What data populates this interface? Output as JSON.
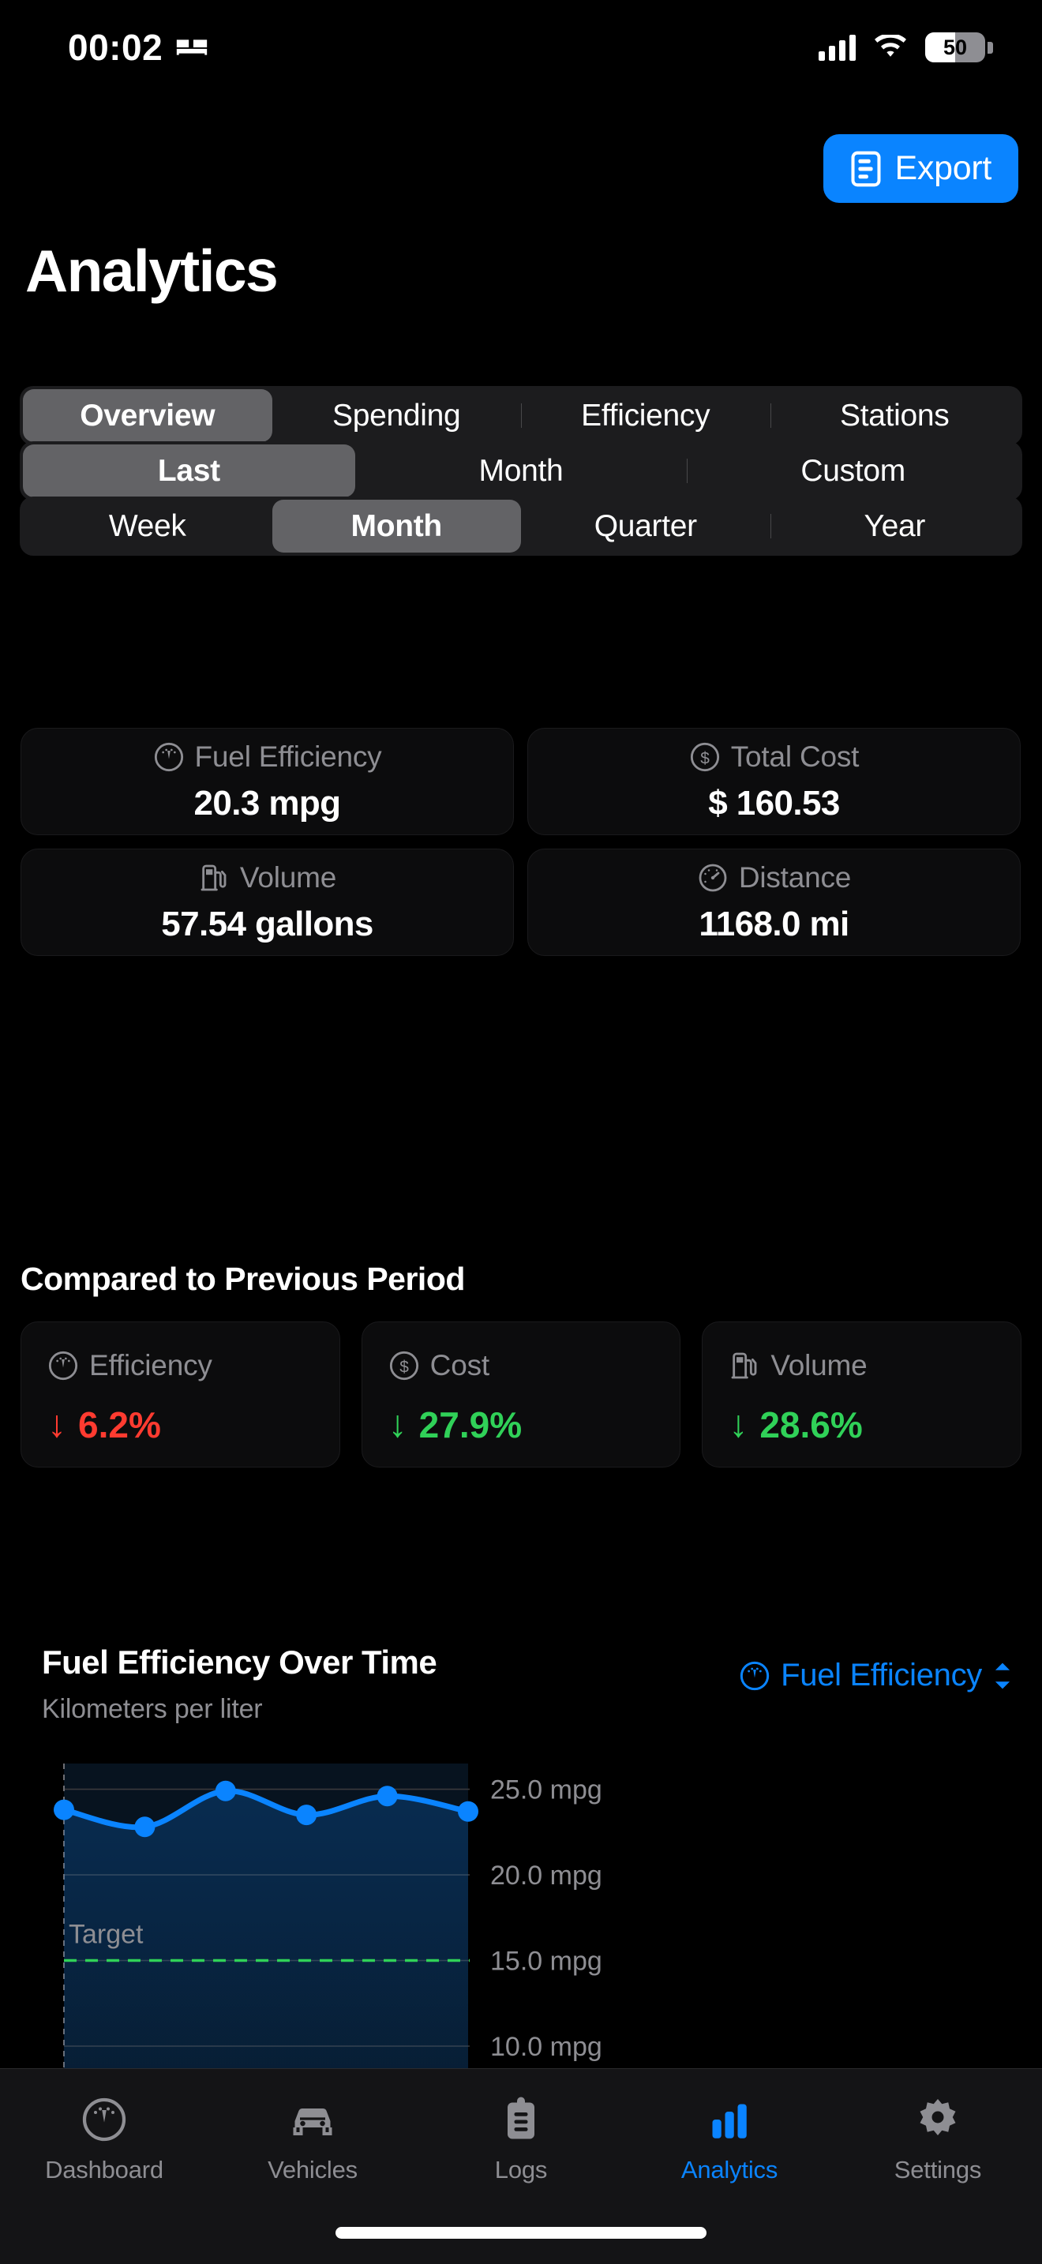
{
  "status_bar": {
    "time": "00:02",
    "sleep_icon": "bed-icon",
    "cellular_icon": "cellular-bars-icon",
    "wifi_icon": "wifi-icon",
    "battery_level": "50",
    "battery_percent": 50
  },
  "header": {
    "title": "Analytics",
    "export_label": "Export",
    "export_icon": "document-list-icon",
    "accent_color": "#0A84FF"
  },
  "segmented": {
    "view": {
      "selected": "Overview",
      "items": [
        {
          "label": "Overview",
          "selected": true,
          "divider": false
        },
        {
          "label": "Spending",
          "selected": false,
          "divider": false
        },
        {
          "label": "Efficiency",
          "selected": false,
          "divider": true
        },
        {
          "label": "Stations",
          "selected": false,
          "divider": true
        }
      ]
    },
    "range_mode": {
      "selected": "Last",
      "items": [
        {
          "label": "Last",
          "selected": true,
          "divider": false
        },
        {
          "label": "Month",
          "selected": false,
          "divider": false
        },
        {
          "label": "Custom",
          "selected": false,
          "divider": true
        }
      ]
    },
    "period": {
      "selected": "Month",
      "items": [
        {
          "label": "Week",
          "selected": false,
          "divider": false
        },
        {
          "label": "Month",
          "selected": true,
          "divider": false
        },
        {
          "label": "Quarter",
          "selected": false,
          "divider": false
        },
        {
          "label": "Year",
          "selected": false,
          "divider": true
        }
      ]
    }
  },
  "stats": [
    {
      "label": "Fuel Efficiency",
      "value": "20.3 mpg",
      "icon": "gauge-icon"
    },
    {
      "label": "Total Cost",
      "value": "$ 160.53",
      "icon": "dollar-circle-icon"
    },
    {
      "label": "Volume",
      "value": "57.54 gallons",
      "icon": "fuel-pump-icon"
    },
    {
      "label": "Distance",
      "value": "1168.0 mi",
      "icon": "speedometer-icon"
    }
  ],
  "comparison": {
    "title": "Compared to Previous Period",
    "items": [
      {
        "label": "Efficiency",
        "icon": "gauge-icon",
        "arrow": "↓",
        "value": "6.2%",
        "color": "#FF3B30"
      },
      {
        "label": "Cost",
        "icon": "dollar-circle-icon",
        "arrow": "↓",
        "value": "27.9%",
        "color": "#30D158"
      },
      {
        "label": "Volume",
        "icon": "fuel-pump-icon",
        "arrow": "↓",
        "value": "28.6%",
        "color": "#30D158"
      }
    ]
  },
  "chart_section": {
    "title": "Fuel Efficiency Over Time",
    "subtitle": "Kilometers per liter",
    "picker_label": "Fuel Efficiency",
    "picker_icon": "gauge-icon",
    "picker_chevron": "chevron-up-down-icon"
  },
  "chart_data": {
    "type": "line",
    "title": "Fuel Efficiency Over Time",
    "subtitle": "Kilometers per liter",
    "xlabel": "",
    "ylabel": "mpg",
    "x": [
      1,
      2,
      3,
      4,
      5,
      6
    ],
    "values": [
      23.8,
      22.8,
      24.9,
      23.5,
      24.6,
      23.7
    ],
    "series": [
      {
        "name": "Fuel Efficiency",
        "values": [
          23.8,
          22.8,
          24.9,
          23.5,
          24.6,
          23.7
        ],
        "color": "#0A84FF"
      }
    ],
    "ylim": [
      10.0,
      26.5
    ],
    "ytick_labels": [
      "25.0 mpg",
      "20.0 mpg",
      "15.0 mpg",
      "10.0 mpg"
    ],
    "ytick_values": [
      25.0,
      20.0,
      15.0,
      10.0
    ],
    "grid": true,
    "legend": false,
    "area_fill": true,
    "target": {
      "label": "Target",
      "value": 15.0,
      "color": "#30D158",
      "dashed": true
    },
    "marker_color": "#0A84FF",
    "line_color": "#0A84FF"
  },
  "tabbar": {
    "active": "Analytics",
    "items": [
      {
        "label": "Dashboard",
        "icon": "gauge-icon",
        "active": false
      },
      {
        "label": "Vehicles",
        "icon": "car-icon",
        "active": false
      },
      {
        "label": "Logs",
        "icon": "clipboard-icon",
        "active": false
      },
      {
        "label": "Analytics",
        "icon": "bar-chart-icon",
        "active": true
      },
      {
        "label": "Settings",
        "icon": "gear-icon",
        "active": false
      }
    ]
  }
}
